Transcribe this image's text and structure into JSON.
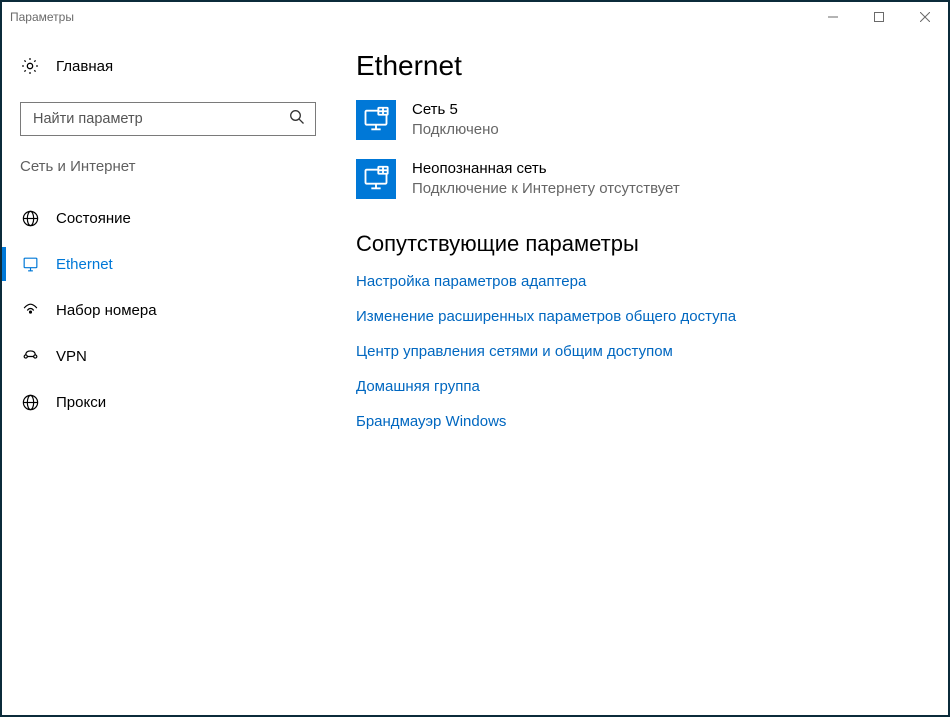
{
  "window": {
    "title": "Параметры"
  },
  "sidebar": {
    "home": "Главная",
    "search_placeholder": "Найти параметр",
    "category": "Сеть и Интернет",
    "items": [
      {
        "label": "Состояние"
      },
      {
        "label": "Ethernet"
      },
      {
        "label": "Набор номера"
      },
      {
        "label": "VPN"
      },
      {
        "label": "Прокси"
      }
    ]
  },
  "main": {
    "title": "Ethernet",
    "networks": [
      {
        "name": "Сеть  5",
        "status": "Подключено"
      },
      {
        "name": "Неопознанная сеть",
        "status": "Подключение к Интернету отсутствует"
      }
    ],
    "related_title": "Сопутствующие параметры",
    "related_links": [
      "Настройка параметров адаптера",
      "Изменение расширенных параметров общего доступа",
      "Центр управления сетями и общим доступом",
      "Домашняя группа",
      "Брандмауэр Windows"
    ]
  }
}
